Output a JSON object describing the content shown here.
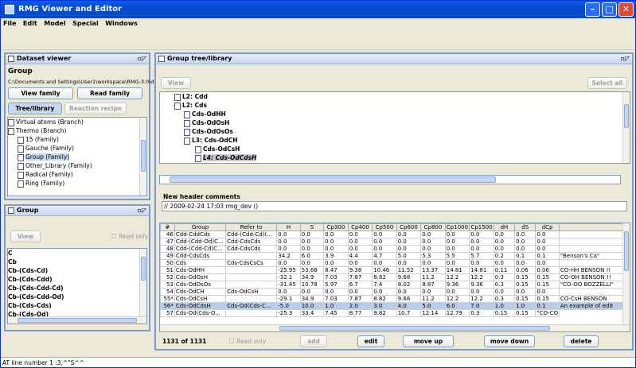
{
  "window": {
    "title": "RMG Viewer and Editor"
  },
  "menu": [
    "File",
    "Edit",
    "Model",
    "Special",
    "Windows"
  ],
  "dataset": {
    "title": "Dataset viewer",
    "group_label": "Group",
    "path": "C:\\Documents and Settings\\User1\\workspace\\RMG-3.0\\d...",
    "view_family": "View family",
    "read_family": "Read family",
    "tree_library": "Tree/library",
    "reaction_recipe": "Reaction recipe",
    "items": [
      "Virtual atoms (Branch)",
      "Thermo (Branch)",
      "15 (Family)",
      "Gauche (Family)",
      "Group (Family)",
      "Other_Library (Family)",
      "Radical (Family)",
      "Ring (Family)"
    ]
  },
  "group": {
    "title": "Group",
    "view": "View",
    "read_only": "Read only",
    "items": [
      "C",
      "Cb",
      "Cb-(Cds-Cd)",
      "Cb-(Cds-Cdd)",
      "Cb-(Cds-Cdd-Cd)",
      "Cb-(Cds-Cdd-Od)",
      "Cb-(Cds-Cds)",
      "Cb-(Cds-Od)"
    ]
  },
  "tree": {
    "title": "Group tree/library",
    "view": "View",
    "select_all": "Select all",
    "nodes": [
      "L2: Cdd",
      "L2: Cds",
      "Cds-OdHH",
      "Cds-OdOsH",
      "Cds-OdOsOs",
      "L3: Cds-OdCH",
      "Cds-OdCsH",
      "L4: Cds-OdCdsH"
    ],
    "header_label": "New header comments",
    "header_value": "// 2009-02-24 17:03 rmg_dev ()"
  },
  "table": {
    "columns": [
      "#",
      "Group",
      "Refer to",
      "H",
      "S",
      "Cp300",
      "Cp400",
      "Cp500",
      "Cp600",
      "Cp800",
      "Cp1000",
      "Cp1500",
      "dH",
      "dS",
      "dCp",
      ""
    ],
    "rows": [
      [
        "46",
        "Cdd-CddCds",
        "Cdd-(Cdd-Cd)(...",
        "0.0",
        "0.0",
        "0.0",
        "0.0",
        "0.0",
        "0.0",
        "0.0",
        "0.0",
        "0.0",
        "0.0",
        "0.0",
        "0.0",
        ""
      ],
      [
        "47",
        "Cdd-(Cdd-Od)C...",
        "Cdd-CdsCds",
        "0.0",
        "0.0",
        "0.0",
        "0.0",
        "0.0",
        "0.0",
        "0.0",
        "0.0",
        "0.0",
        "0.0",
        "0.0",
        "0.0",
        ""
      ],
      [
        "48",
        "Cdd-(Cdd-Cd)C...",
        "Cdd-CdsCds",
        "0.0",
        "0.0",
        "0.0",
        "0.0",
        "0.0",
        "0.0",
        "0.0",
        "0.0",
        "0.0",
        "0.0",
        "0.0",
        "0.0",
        ""
      ],
      [
        "49",
        "Cdd-CdsCds",
        "",
        "34.2",
        "6.0",
        "3.9",
        "4.4",
        "4.7",
        "5.0",
        "5.3",
        "5.5",
        "5.7",
        "0.2",
        "0.1",
        "0.1",
        "\"Benson's Ca\""
      ],
      [
        "50",
        "Cds",
        "Cds-CdsCsCs",
        "0.0",
        "0.0",
        "0.0",
        "0.0",
        "0.0",
        "0.0",
        "0.0",
        "0.0",
        "0.0",
        "0.0",
        "0.0",
        "0.0",
        ""
      ],
      [
        "51",
        "Cds-OdHH",
        "",
        "-25.95",
        "53.68",
        "8.47",
        "9.38",
        "10.46",
        "11.52",
        "13.37",
        "14.81",
        "14.81",
        "0.11",
        "0.06",
        "0.06",
        "CO-HH BENSON !!"
      ],
      [
        "52",
        "Cds-OdOsH",
        "",
        "-32.1",
        "34.9",
        "7.03",
        "7.87",
        "8.82",
        "9.68",
        "11.2",
        "12.2",
        "12.2",
        "0.3",
        "0.15",
        "0.15",
        "CO-OH BENSON !!"
      ],
      [
        "53",
        "Cds-OdOsOs",
        "",
        "-31.45",
        "10.78",
        "5.97",
        "6.7",
        "7.4",
        "8.02",
        "8.87",
        "9.36",
        "9.36",
        "0.3",
        "0.15",
        "0.15",
        "\"CO-OO BOZZELLI\""
      ],
      [
        "54",
        "Cds-OdCH",
        "Cds-OdCsH",
        "0.0",
        "0.0",
        "0.0",
        "0.0",
        "0.0",
        "0.0",
        "0.0",
        "0.0",
        "0.0",
        "0.0",
        "0.0",
        "0.0",
        ""
      ],
      [
        "55*",
        "Cds-OdCsH",
        "",
        "-29.1",
        "34.9",
        "7.03",
        "7.87",
        "8.82",
        "9.68",
        "11.2",
        "12.2",
        "12.2",
        "0.3",
        "0.15",
        "0.15",
        "CO-CsH BENSON"
      ],
      [
        "56*",
        "Cds-OdCdsH",
        "Cds-Od(Cds-C...",
        "-5.0",
        "10.0",
        "1.0",
        "2.0",
        "3.0",
        "4.0",
        "5.0",
        "6.0",
        "7.0",
        "1.0",
        "1.0",
        "0.1",
        "An example of edit"
      ],
      [
        "57",
        "Cds-Od(Cds-O...",
        "",
        "-25.3",
        "33.4",
        "7.45",
        "8.77",
        "9.82",
        "10.7",
        "12.14",
        "12.79",
        "0.3",
        "0.15",
        "0.15",
        "\"CO-CO H BENSON"
      ]
    ],
    "count": "1131 of 1131",
    "read_only": "Read only",
    "add": "add",
    "edit": "edit",
    "move_up": "move up",
    "move_down": "move down",
    "delete": "delete"
  },
  "status": "AT line number 1 :3,^\"S^^"
}
